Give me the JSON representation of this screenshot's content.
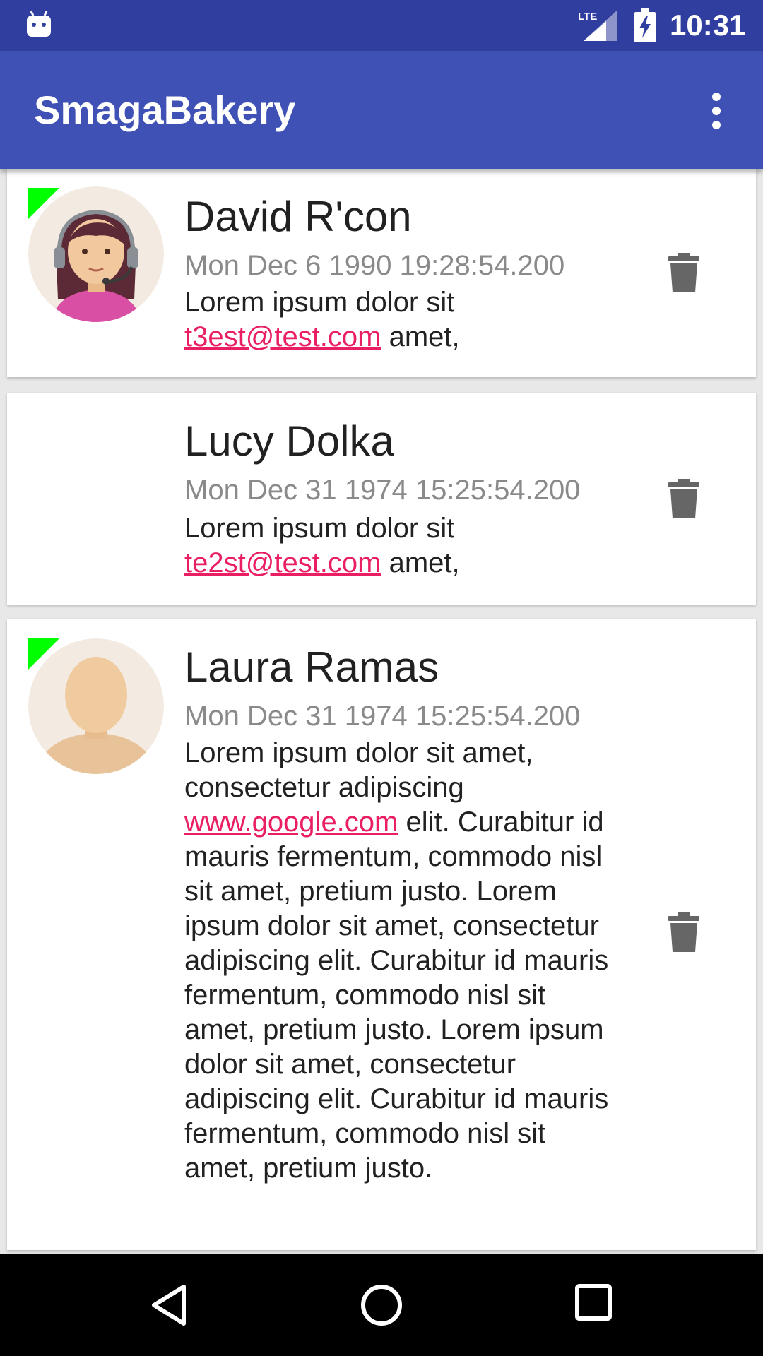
{
  "status_bar": {
    "time": "10:31",
    "network": "LTE",
    "icons": [
      "android-icon",
      "lte-signal-icon",
      "battery-charging-icon"
    ]
  },
  "app_bar": {
    "title": "SmagaBakery",
    "menu_icon": "more-vert-icon"
  },
  "colors": {
    "status_bar": "#303f9f",
    "app_bar": "#3f51b5",
    "link": "#e91e63",
    "unread_marker": "#00ff00"
  },
  "cards": [
    {
      "name": "David R'con",
      "date": "Mon Dec 6 1990 19:28:54.200",
      "text_before": "Lorem ipsum dolor sit ",
      "link": "t3est@test.com",
      "text_after": " amet,",
      "avatar": "support-agent-avatar",
      "delete_icon": "trash-icon"
    },
    {
      "name": "Lucy Dolka",
      "date": "Mon Dec 31 1974 15:25:54.200",
      "text_before": "Lorem ipsum dolor sit ",
      "link": "te2st@test.com",
      "text_after": " amet,",
      "delete_icon": "trash-icon"
    },
    {
      "name": "Laura Ramas",
      "date": "Mon Dec 31 1974 15:25:54.200",
      "text_before": "Lorem ipsum dolor sit amet, consectetur adipiscing ",
      "link": "www.google.com",
      "text_after": " elit. Curabitur id mauris fermentum, commodo nisl sit amet, pretium justo. Lorem ipsum dolor sit amet, consectetur adipiscing elit. Curabitur id mauris fermentum, commodo nisl sit amet, pretium justo. Lorem ipsum dolor sit amet, consectetur adipiscing elit. Curabitur id mauris fermentum, commodo nisl sit amet, pretium justo.",
      "avatar": "default-person-avatar",
      "delete_icon": "trash-icon"
    }
  ],
  "nav_bar": {
    "icons": [
      "back-icon",
      "home-icon",
      "recents-icon"
    ]
  }
}
